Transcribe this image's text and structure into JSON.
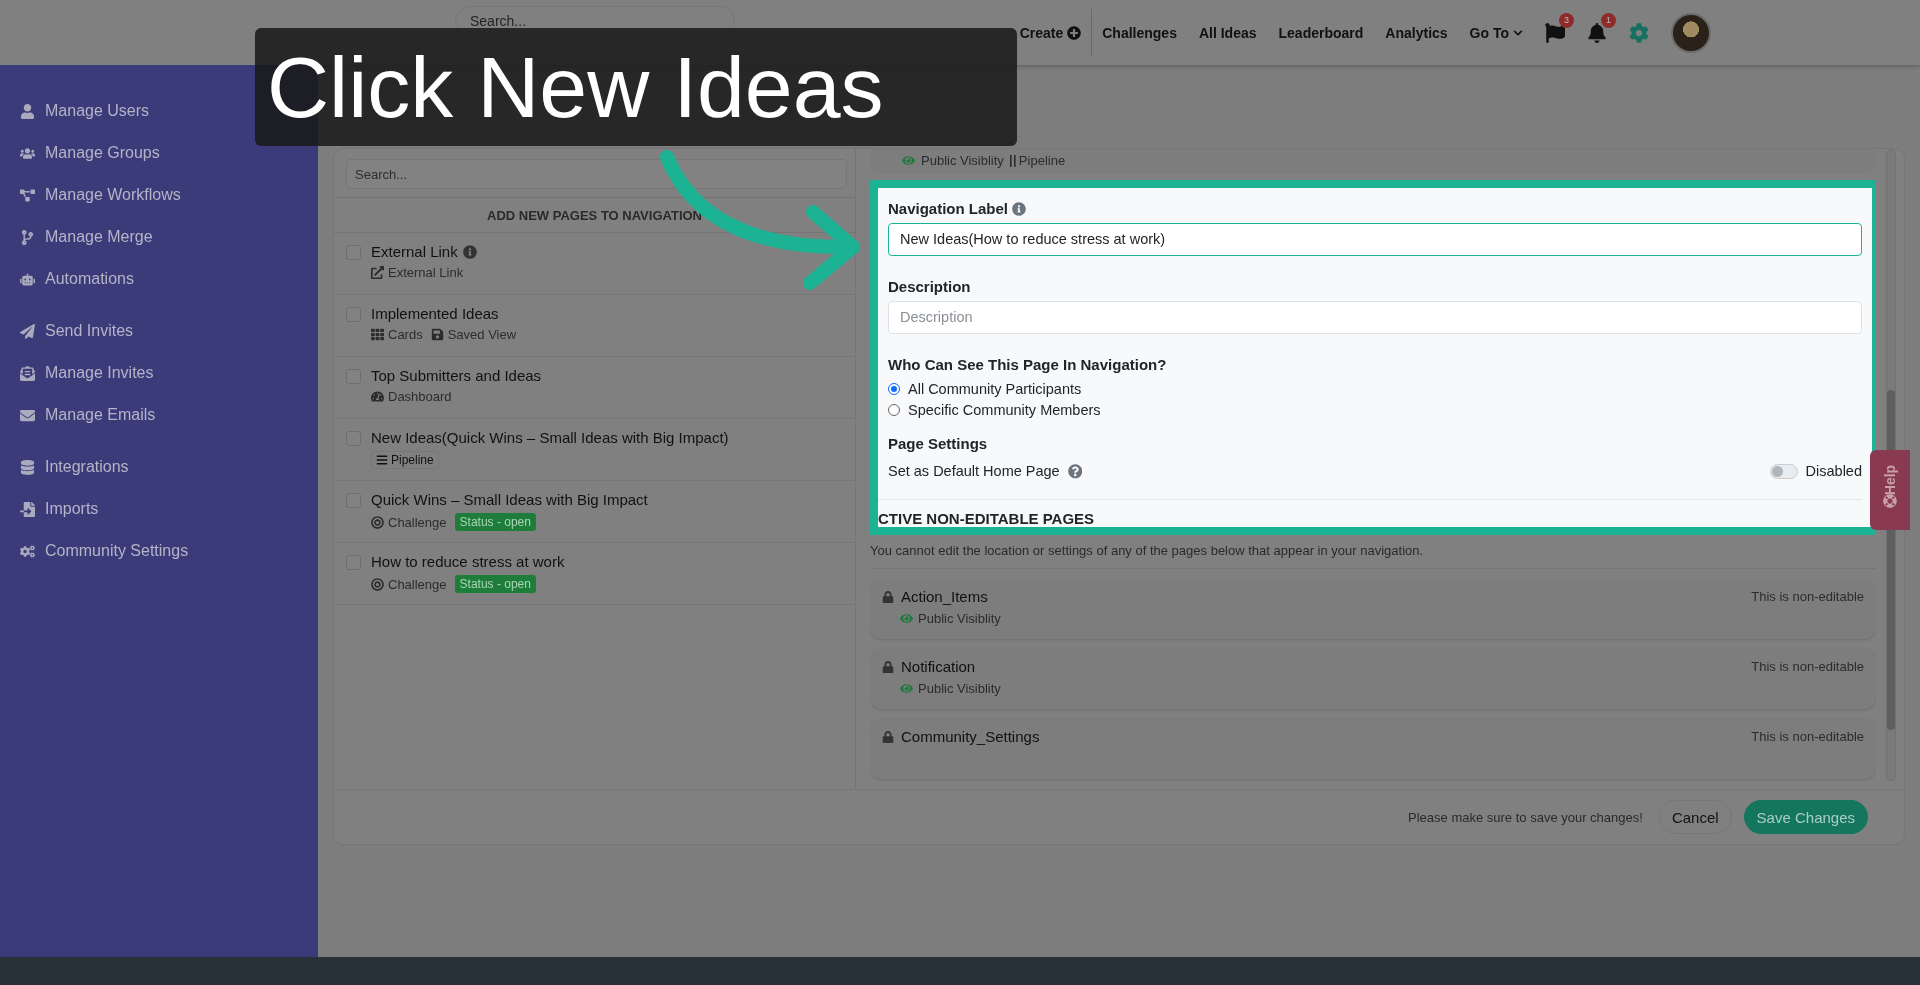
{
  "caption": {
    "text": "Click New Ideas"
  },
  "topbar": {
    "search": {
      "placeholder": "Search..."
    },
    "create": "Create",
    "nav": [
      "Challenges",
      "All Ideas",
      "Leaderboard",
      "Analytics"
    ],
    "goto": "Go To",
    "flag_badge": "3",
    "bell_badge": "1"
  },
  "sidebar": {
    "groups": [
      {
        "items": [
          "Manage Users",
          "Manage Groups",
          "Manage Workflows",
          "Manage Merge",
          "Automations"
        ]
      },
      {
        "items": [
          "Send Invites",
          "Manage Invites",
          "Manage Emails"
        ]
      },
      {
        "items": [
          "Integrations",
          "Imports",
          "Community Settings"
        ]
      }
    ]
  },
  "left_panel": {
    "search": {
      "placeholder": "Search..."
    },
    "heading": "ADD NEW PAGES TO NAVIGATION",
    "pages": [
      {
        "title": "External Link",
        "checked": false,
        "info": true,
        "tags": [
          {
            "kind": "link",
            "label": "External Link"
          }
        ]
      },
      {
        "title": "Implemented Ideas",
        "checked": false,
        "info": false,
        "tags": [
          {
            "kind": "cards",
            "label": "Cards"
          },
          {
            "kind": "saved",
            "label": "Saved View"
          }
        ]
      },
      {
        "title": "Top Submitters and Ideas",
        "checked": false,
        "info": false,
        "tags": [
          {
            "kind": "dashboard",
            "label": "Dashboard"
          }
        ]
      },
      {
        "title": "New Ideas(Quick Wins – Small Ideas with Big Impact)",
        "checked": false,
        "info": false,
        "tags": [
          {
            "kind": "pipeline",
            "label": "Pipeline"
          }
        ]
      },
      {
        "title": "Quick Wins – Small Ideas with Big Impact",
        "checked": false,
        "info": false,
        "tags": [
          {
            "kind": "challenge",
            "label": "Challenge"
          },
          {
            "kind": "status",
            "label": "Status - open"
          }
        ]
      },
      {
        "title": "How to reduce stress at work",
        "checked": false,
        "info": false,
        "tags": [
          {
            "kind": "challenge",
            "label": "Challenge"
          },
          {
            "kind": "status",
            "label": "Status - open"
          }
        ]
      }
    ]
  },
  "right_panel": {
    "partial_item": {
      "visibility": "Public Visiblity",
      "type": "Pipeline"
    },
    "form": {
      "label_title": "Navigation Label",
      "label_value": "New Ideas(How to reduce stress at work)",
      "description_title": "Description",
      "description_placeholder": "Description",
      "visibility_title": "Who Can See This Page In Navigation?",
      "options": [
        {
          "label": "All Community Participants",
          "selected": true
        },
        {
          "label": "Specific Community Members",
          "selected": false
        }
      ],
      "settings_title": "Page Settings",
      "default_home": {
        "label": "Set as Default Home Page",
        "on": false,
        "state": "Disabled"
      }
    },
    "section_heading": "CTIVE NON-EDITABLE PAGES",
    "note": "You cannot edit the location or settings of any of the pages below that appear in your navigation.",
    "locked_pages": [
      {
        "name": "Action_Items",
        "visibility": "Public Visiblity",
        "status": "This is non-editable"
      },
      {
        "name": "Notification",
        "visibility": "Public Visiblity",
        "status": "This is non-editable"
      },
      {
        "name": "Community_Settings",
        "status": "This is non-editable"
      }
    ]
  },
  "footer": {
    "reminder": "Please make sure to save your changes!",
    "buttons": [
      {
        "label": "Cancel",
        "kind": "secondary"
      },
      {
        "label": "Save Changes",
        "kind": "primary"
      }
    ]
  },
  "help": {
    "label": "Help"
  }
}
